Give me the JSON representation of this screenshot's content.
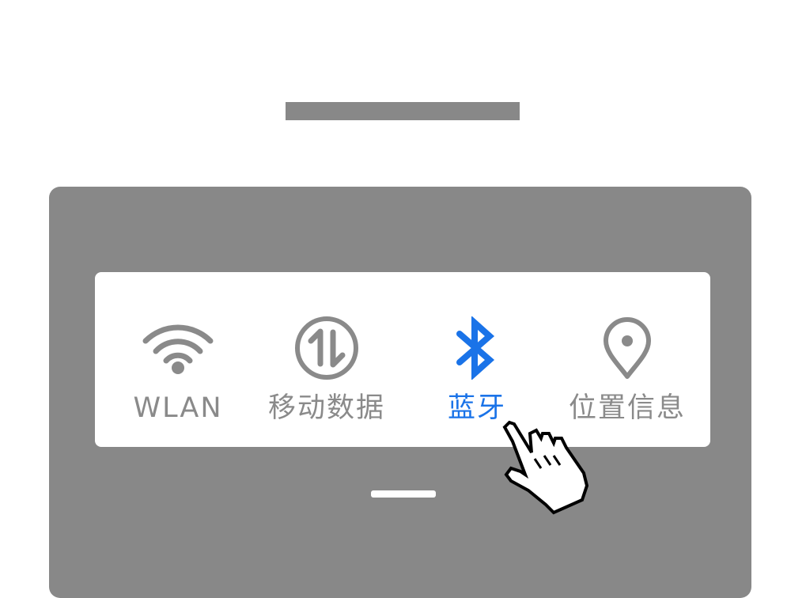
{
  "quick_settings": {
    "tiles": [
      {
        "label": "WLAN",
        "icon": "wifi-icon",
        "active": false
      },
      {
        "label": "移动数据",
        "icon": "mobile-data-icon",
        "active": false
      },
      {
        "label": "蓝牙",
        "icon": "bluetooth-icon",
        "active": true
      },
      {
        "label": "位置信息",
        "icon": "location-pin-icon",
        "active": false
      }
    ]
  },
  "colors": {
    "active": "#1a73e8",
    "inactive": "#8a8a8a",
    "panel": "#888888",
    "card": "#ffffff"
  },
  "cursor": {
    "icon": "hand-pointer-icon"
  }
}
